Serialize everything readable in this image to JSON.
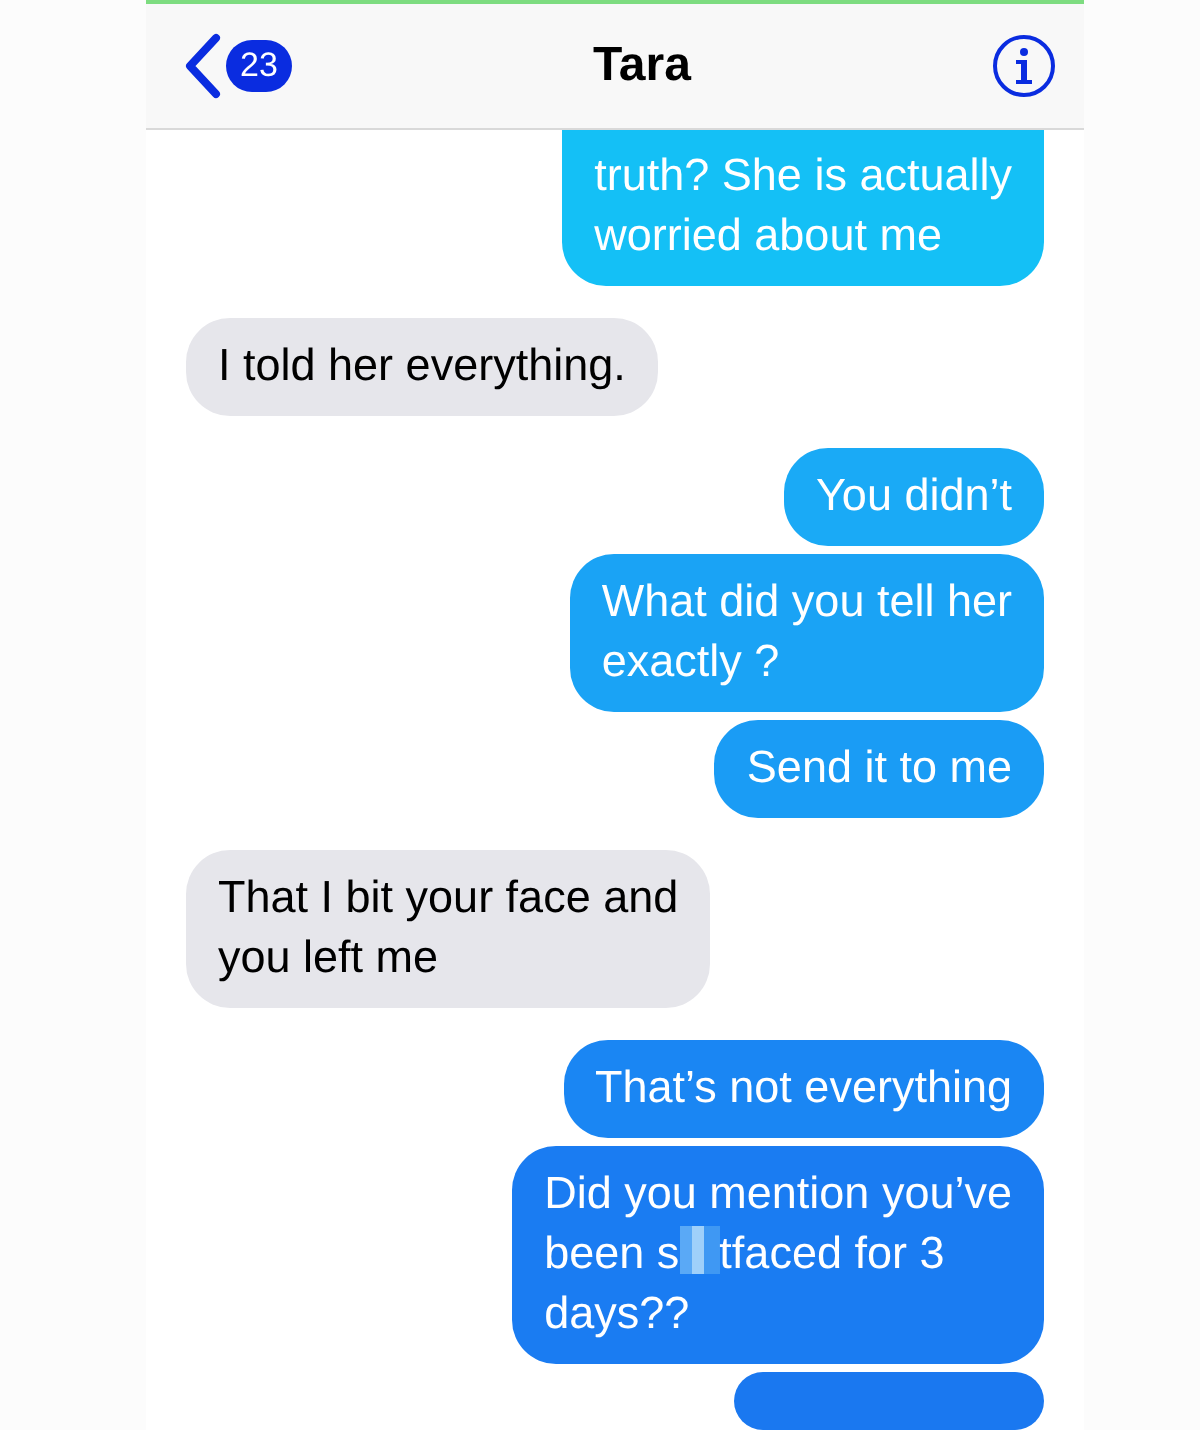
{
  "header": {
    "back_badge": "23",
    "title": "Tara"
  },
  "messages": [
    {
      "kind": "sent",
      "color": "#14c0f6",
      "parts": [
        {
          "kind": "text",
          "text": "truth? She is actually\nworried about me"
        }
      ]
    },
    {
      "kind": "received",
      "color": "#e6e6eb",
      "parts": [
        {
          "kind": "text",
          "text": "I told her everything."
        }
      ]
    },
    {
      "kind": "sent",
      "color": "#1aaaf6",
      "parts": [
        {
          "kind": "text",
          "text": "You didn’t"
        }
      ]
    },
    {
      "kind": "sent",
      "color": "#1aa3f5",
      "parts": [
        {
          "kind": "text",
          "text": "What did you tell her\nexactly ?"
        }
      ]
    },
    {
      "kind": "sent",
      "color": "#1a9cf5",
      "parts": [
        {
          "kind": "text",
          "text": "Send it to me"
        }
      ]
    },
    {
      "kind": "received",
      "color": "#e6e6eb",
      "parts": [
        {
          "kind": "text",
          "text": "That I bit your face and\nyou left me"
        }
      ]
    },
    {
      "kind": "sent",
      "color": "#1a86f3",
      "parts": [
        {
          "kind": "text",
          "text": "That’s not everything"
        }
      ]
    },
    {
      "kind": "sent",
      "color": "#1a7cf2",
      "parts": [
        {
          "kind": "text",
          "text": "Did you mention you’ve\nbeen s"
        },
        {
          "kind": "censor"
        },
        {
          "kind": "text",
          "text": "tfaced for 3\ndays??"
        }
      ]
    },
    {
      "kind": "sent",
      "color": "#1a78f0"
    }
  ]
}
